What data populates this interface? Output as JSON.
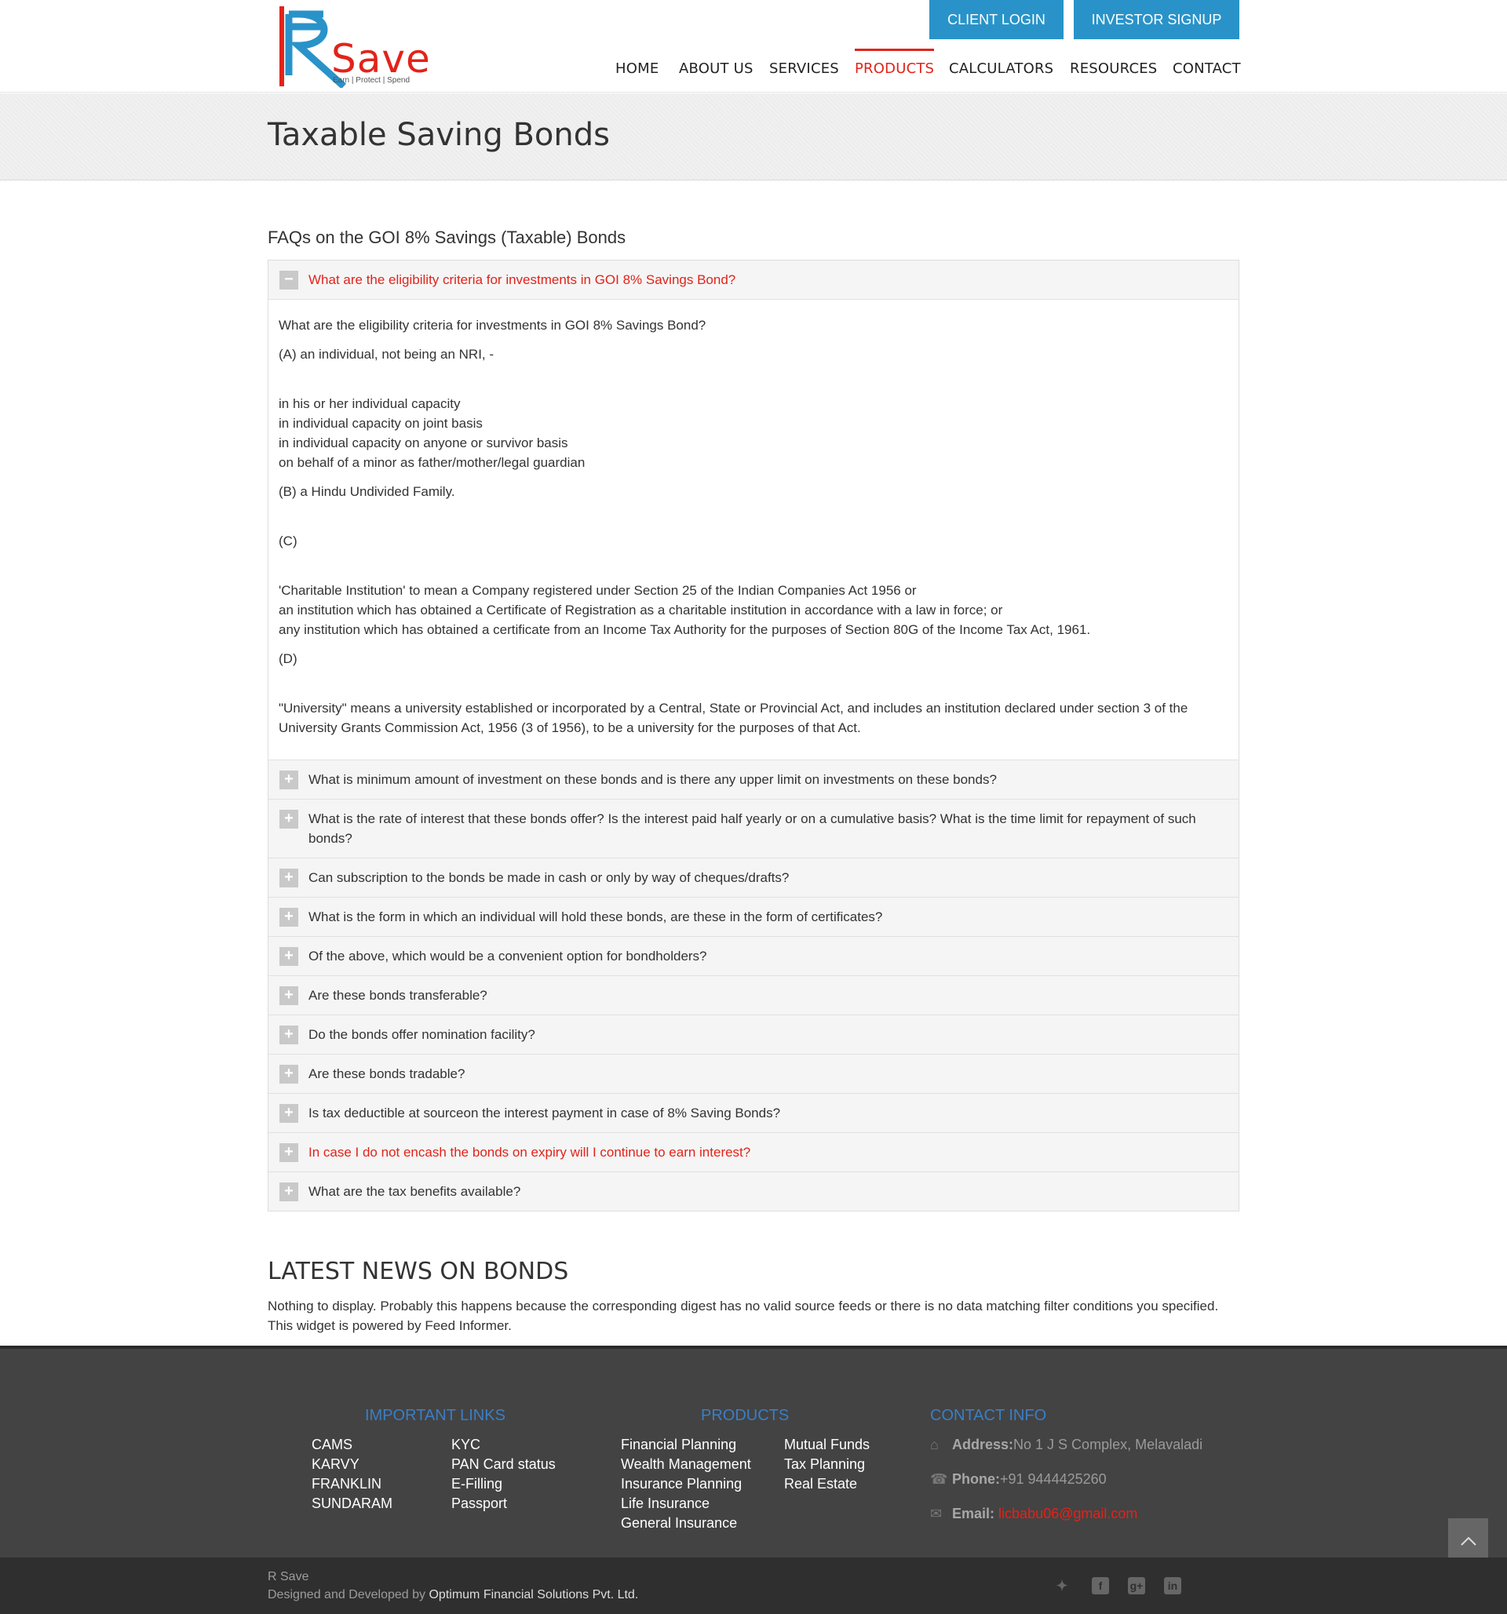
{
  "header": {
    "logo_text": "Save",
    "logo_tagline": "Earn | Protect | Spend",
    "client_login": "CLIENT LOGIN",
    "investor_signup": "INVESTOR SIGNUP",
    "nav": [
      "HOME",
      "ABOUT US",
      "SERVICES",
      "PRODUCTS",
      "CALCULATORS",
      "RESOURCES",
      "CONTACT"
    ],
    "active_nav": "PRODUCTS"
  },
  "page_title": "Taxable Saving Bonds",
  "faq": {
    "heading": "FAQs on the GOI 8% Savings (Taxable) Bonds",
    "open_question": "What are the eligibility criteria for investments in GOI 8% Savings Bond?",
    "answer": {
      "intro": "What are the eligibility criteria for investments in GOI 8% Savings Bond?",
      "a": "(A) an individual, not being an NRI, -",
      "a_list": [
        "in his or her individual capacity",
        "in individual capacity on joint basis",
        "in individual capacity on anyone or survivor basis",
        "on behalf of a minor as father/mother/legal guardian"
      ],
      "b": "(B) a Hindu Undivided Family.",
      "c": "(C)",
      "c_list": [
        "'Charitable Institution' to mean a Company registered under Section 25 of the Indian Companies Act 1956 or",
        "an institution which has obtained a Certificate of Registration as a charitable institution in accordance with a law in force; or",
        "any institution which has obtained a certificate from an Income Tax Authority for the purposes of Section 80G of the Income Tax Act, 1961."
      ],
      "d": "(D)",
      "d_text": "\"University\" means a university established or incorporated by a Central, State or Provincial Act, and includes an institution declared under section 3 of the University Grants Commission Act, 1956 (3 of 1956), to be a university for the purposes of that Act."
    },
    "collapsed_questions": [
      "What is minimum amount of investment on these bonds and is there any upper limit on investments on these bonds?",
      "What is the rate of interest that these bonds offer? Is the interest paid half yearly or on a cumulative basis? What is the time limit for repayment of such bonds?",
      "Can subscription to the bonds be made in cash or only by way of cheques/drafts?",
      "What is the form in which an individual will hold these bonds, are these in the form of certificates?",
      "Of the above, which would be a convenient option for bondholders?",
      "Are these bonds transferable?",
      "Do the bonds offer nomination facility?",
      "Are these bonds tradable?",
      "Is tax deductible at sourceon the interest payment in case of 8% Saving Bonds?",
      "In case I do not encash the bonds on expiry will I continue to earn interest?",
      "What are the tax benefits available?"
    ],
    "highlighted_question_index": 9
  },
  "news": {
    "heading": "LATEST NEWS ON BONDS",
    "text": "Nothing to display. Probably this happens because the corresponding digest has no valid source feeds or there is no data matching filter conditions you specified. This widget is powered by Feed Informer."
  },
  "footer": {
    "important_links_heading": "IMPORTANT LINKS",
    "important_links_col1": [
      "CAMS",
      "KARVY",
      "FRANKLIN",
      "SUNDARAM"
    ],
    "important_links_col2": [
      "KYC",
      "PAN Card status",
      "E-Filling",
      "Passport"
    ],
    "products_heading": "PRODUCTS",
    "products_col1": [
      "Financial Planning",
      "Wealth Management",
      "Insurance Planning",
      "Life Insurance",
      "General Insurance"
    ],
    "products_col2": [
      "Mutual Funds",
      "Tax Planning",
      "Real Estate"
    ],
    "contact_heading": "CONTACT INFO",
    "address_label": "Address:",
    "address_value": "No 1 J S Complex, Melavaladi",
    "phone_label": "Phone:",
    "phone_value": "+91 9444425260",
    "email_label": "Email:",
    "email_value": "licbabu06@gmail.com"
  },
  "bottom": {
    "site": "R Save",
    "designed_prefix": "Designed and Developed by ",
    "developer": "Optimum Financial Solutions Pvt. Ltd.",
    "social_icons": [
      "twitter-icon",
      "facebook-icon",
      "google-plus-icon",
      "linkedin-icon"
    ]
  },
  "colors": {
    "brand_red": "#e2231a",
    "brand_blue": "#2993c9",
    "footer_bg": "#434343",
    "bottom_bg": "#2f2f2f"
  }
}
